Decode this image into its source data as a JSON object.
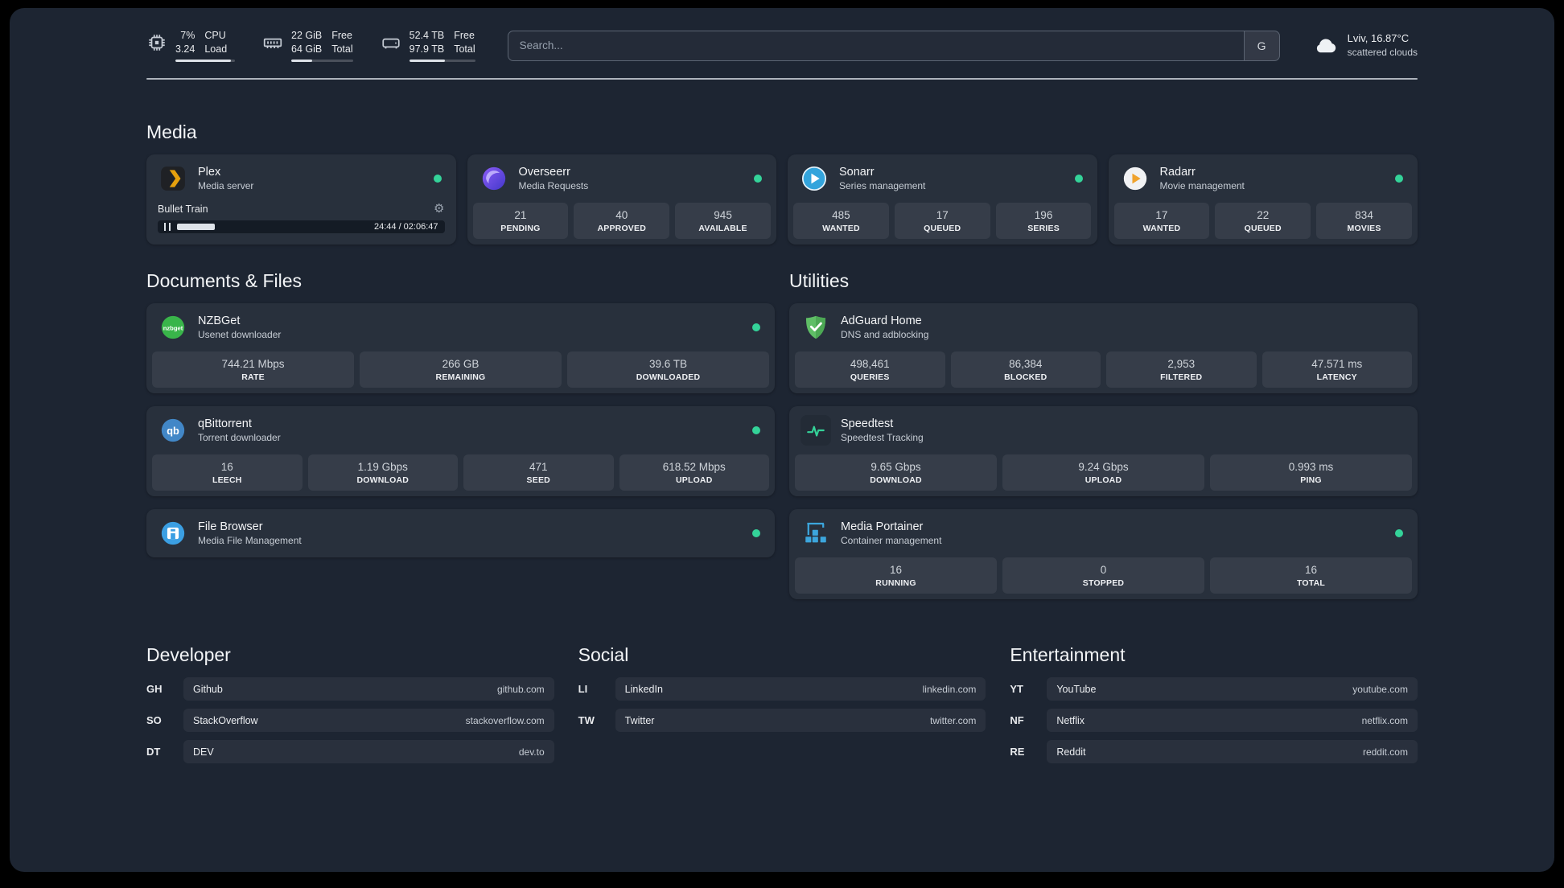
{
  "colors": {
    "status_online": "#34d399",
    "page_bg": "#1d2532",
    "accent_green": "#34d399"
  },
  "header": {
    "cpu": {
      "value_top": "7%",
      "value_bottom": "3.24",
      "label_top": "CPU",
      "label_bottom": "Load",
      "bar_percent": 93
    },
    "memory": {
      "value_top": "22 GiB",
      "value_bottom": "64 GiB",
      "label_top": "Free",
      "label_bottom": "Total",
      "bar_percent": 34
    },
    "disk": {
      "value_top": "52.4 TB",
      "value_bottom": "97.9 TB",
      "label_top": "Free",
      "label_bottom": "Total",
      "bar_percent": 54
    },
    "search": {
      "placeholder": "Search...",
      "provider": "G"
    },
    "weather": {
      "location": "Lviv, 16.87°C",
      "condition": "scattered clouds"
    }
  },
  "sections": {
    "media": {
      "title": "Media",
      "cards": [
        {
          "title": "Plex",
          "subtitle": "Media server",
          "online": true,
          "player": {
            "track": "Bullet Train",
            "time": "24:44 / 02:06:47",
            "progress_percent": 20
          }
        },
        {
          "title": "Overseerr",
          "subtitle": "Media Requests",
          "online": true,
          "stats": [
            {
              "value": "21",
              "label": "PENDING"
            },
            {
              "value": "40",
              "label": "APPROVED"
            },
            {
              "value": "945",
              "label": "AVAILABLE"
            }
          ]
        },
        {
          "title": "Sonarr",
          "subtitle": "Series management",
          "online": true,
          "stats": [
            {
              "value": "485",
              "label": "WANTED"
            },
            {
              "value": "17",
              "label": "QUEUED"
            },
            {
              "value": "196",
              "label": "SERIES"
            }
          ]
        },
        {
          "title": "Radarr",
          "subtitle": "Movie management",
          "online": true,
          "stats": [
            {
              "value": "17",
              "label": "WANTED"
            },
            {
              "value": "22",
              "label": "QUEUED"
            },
            {
              "value": "834",
              "label": "MOVIES"
            }
          ]
        }
      ]
    },
    "documents": {
      "title": "Documents & Files",
      "cards": [
        {
          "title": "NZBGet",
          "subtitle": "Usenet downloader",
          "online": true,
          "stats": [
            {
              "value": "744.21 Mbps",
              "label": "RATE"
            },
            {
              "value": "266 GB",
              "label": "REMAINING"
            },
            {
              "value": "39.6 TB",
              "label": "DOWNLOADED"
            }
          ]
        },
        {
          "title": "qBittorrent",
          "subtitle": "Torrent downloader",
          "online": true,
          "stats": [
            {
              "value": "16",
              "label": "LEECH"
            },
            {
              "value": "1.19 Gbps",
              "label": "DOWNLOAD"
            },
            {
              "value": "471",
              "label": "SEED"
            },
            {
              "value": "618.52 Mbps",
              "label": "UPLOAD"
            }
          ]
        },
        {
          "title": "File Browser",
          "subtitle": "Media File Management",
          "online": true,
          "stats": []
        }
      ]
    },
    "utilities": {
      "title": "Utilities",
      "cards": [
        {
          "title": "AdGuard Home",
          "subtitle": "DNS and adblocking",
          "online": false,
          "stats": [
            {
              "value": "498,461",
              "label": "QUERIES"
            },
            {
              "value": "86,384",
              "label": "BLOCKED"
            },
            {
              "value": "2,953",
              "label": "FILTERED"
            },
            {
              "value": "47.571 ms",
              "label": "LATENCY"
            }
          ]
        },
        {
          "title": "Speedtest",
          "subtitle": "Speedtest Tracking",
          "online": false,
          "stats": [
            {
              "value": "9.65 Gbps",
              "label": "DOWNLOAD"
            },
            {
              "value": "9.24 Gbps",
              "label": "UPLOAD"
            },
            {
              "value": "0.993 ms",
              "label": "PING"
            }
          ]
        },
        {
          "title": "Media Portainer",
          "subtitle": "Container management",
          "online": true,
          "stats": [
            {
              "value": "16",
              "label": "RUNNING"
            },
            {
              "value": "0",
              "label": "STOPPED"
            },
            {
              "value": "16",
              "label": "TOTAL"
            }
          ]
        }
      ]
    }
  },
  "bookmarks": [
    {
      "title": "Developer",
      "items": [
        {
          "abbr": "GH",
          "name": "Github",
          "domain": "github.com"
        },
        {
          "abbr": "SO",
          "name": "StackOverflow",
          "domain": "stackoverflow.com"
        },
        {
          "abbr": "DT",
          "name": "DEV",
          "domain": "dev.to"
        }
      ]
    },
    {
      "title": "Social",
      "items": [
        {
          "abbr": "LI",
          "name": "LinkedIn",
          "domain": "linkedin.com"
        },
        {
          "abbr": "TW",
          "name": "Twitter",
          "domain": "twitter.com"
        }
      ]
    },
    {
      "title": "Entertainment",
      "items": [
        {
          "abbr": "YT",
          "name": "YouTube",
          "domain": "youtube.com"
        },
        {
          "abbr": "NF",
          "name": "Netflix",
          "domain": "netflix.com"
        },
        {
          "abbr": "RE",
          "name": "Reddit",
          "domain": "reddit.com"
        }
      ]
    }
  ]
}
